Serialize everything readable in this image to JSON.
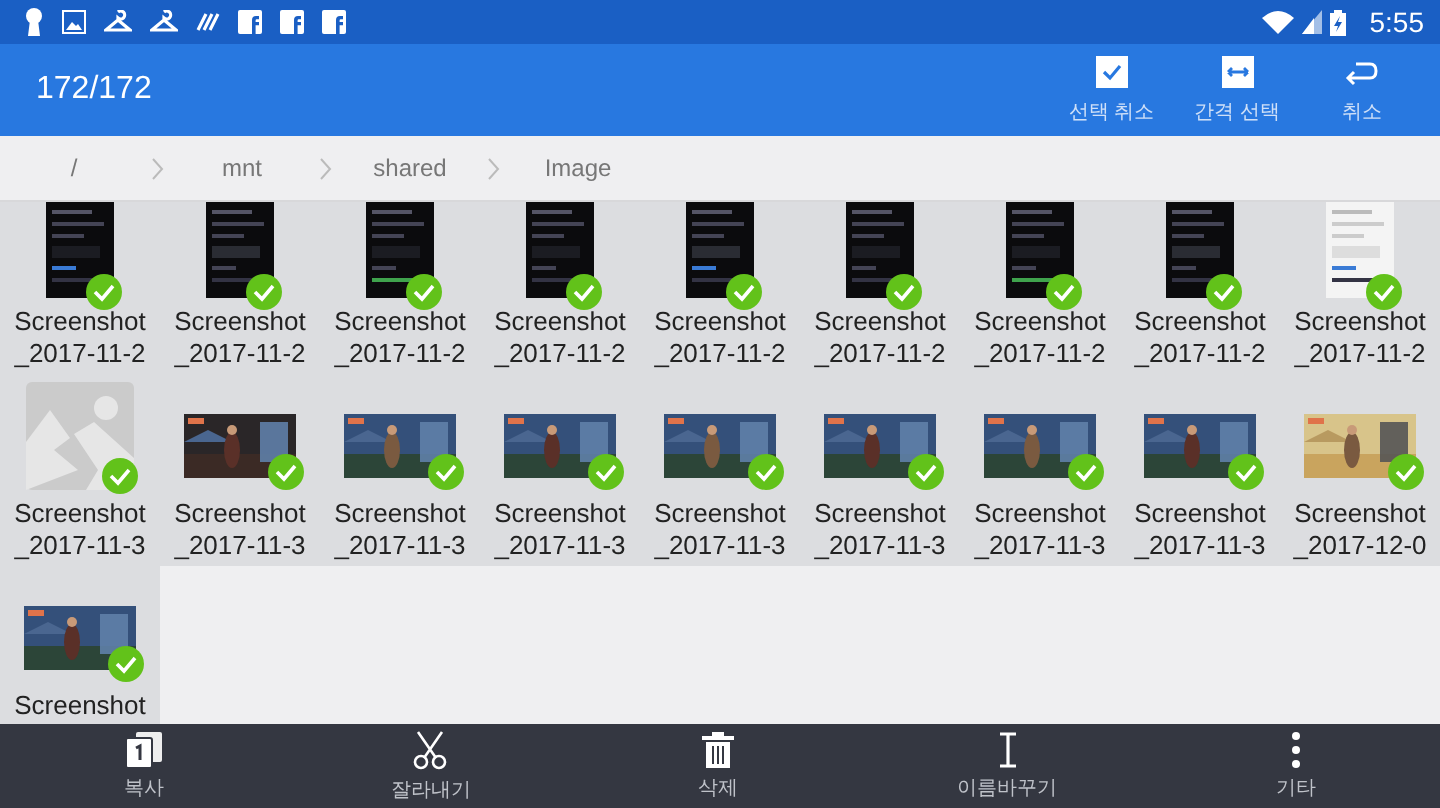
{
  "status_bar": {
    "time": "5:55"
  },
  "app_bar": {
    "title": "172/172",
    "actions": [
      {
        "kind": "check",
        "label": "선택 취소"
      },
      {
        "kind": "range",
        "label": "간격 선택"
      },
      {
        "kind": "back",
        "label": "취소"
      }
    ]
  },
  "breadcrumb": [
    "/",
    "mnt",
    "shared",
    "Image"
  ],
  "files": [
    {
      "kind": "portrait",
      "lines": [
        "Screenshot",
        "_2017-11-2"
      ],
      "selected": true
    },
    {
      "kind": "portrait",
      "lines": [
        "Screenshot",
        "_2017-11-2"
      ],
      "selected": true
    },
    {
      "kind": "portrait",
      "lines": [
        "Screenshot",
        "_2017-11-2"
      ],
      "selected": true
    },
    {
      "kind": "portrait",
      "lines": [
        "Screenshot",
        "_2017-11-2"
      ],
      "selected": true
    },
    {
      "kind": "portrait",
      "lines": [
        "Screenshot",
        "_2017-11-2"
      ],
      "selected": true
    },
    {
      "kind": "portrait",
      "lines": [
        "Screenshot",
        "_2017-11-2"
      ],
      "selected": true
    },
    {
      "kind": "portrait",
      "lines": [
        "Screenshot",
        "_2017-11-2"
      ],
      "selected": true
    },
    {
      "kind": "portrait",
      "lines": [
        "Screenshot",
        "_2017-11-2"
      ],
      "selected": true
    },
    {
      "kind": "portrait",
      "lines": [
        "Screenshot",
        "_2017-11-2"
      ],
      "selected": true
    },
    {
      "kind": "broken",
      "lines": [
        "Screenshot",
        "_2017-11-3"
      ],
      "selected": true
    },
    {
      "kind": "landscape",
      "lines": [
        "Screenshot",
        "_2017-11-3"
      ],
      "selected": true
    },
    {
      "kind": "landscape",
      "lines": [
        "Screenshot",
        "_2017-11-3"
      ],
      "selected": true
    },
    {
      "kind": "landscape",
      "lines": [
        "Screenshot",
        "_2017-11-3"
      ],
      "selected": true
    },
    {
      "kind": "landscape",
      "lines": [
        "Screenshot",
        "_2017-11-3"
      ],
      "selected": true
    },
    {
      "kind": "landscape",
      "lines": [
        "Screenshot",
        "_2017-11-3"
      ],
      "selected": true
    },
    {
      "kind": "landscape",
      "lines": [
        "Screenshot",
        "_2017-11-3"
      ],
      "selected": true
    },
    {
      "kind": "landscape",
      "lines": [
        "Screenshot",
        "_2017-11-3"
      ],
      "selected": true
    },
    {
      "kind": "landscape",
      "lines": [
        "Screenshot",
        "_2017-12-0"
      ],
      "selected": true
    },
    {
      "kind": "landscape",
      "lines": [
        "Screenshot"
      ],
      "selected": true
    }
  ],
  "bottom_bar": [
    {
      "kind": "copy",
      "label": "복사"
    },
    {
      "kind": "cut",
      "label": "잘라내기"
    },
    {
      "kind": "delete",
      "label": "삭제"
    },
    {
      "kind": "rename",
      "label": "이름바꾸기"
    },
    {
      "kind": "more",
      "label": "기타"
    }
  ]
}
